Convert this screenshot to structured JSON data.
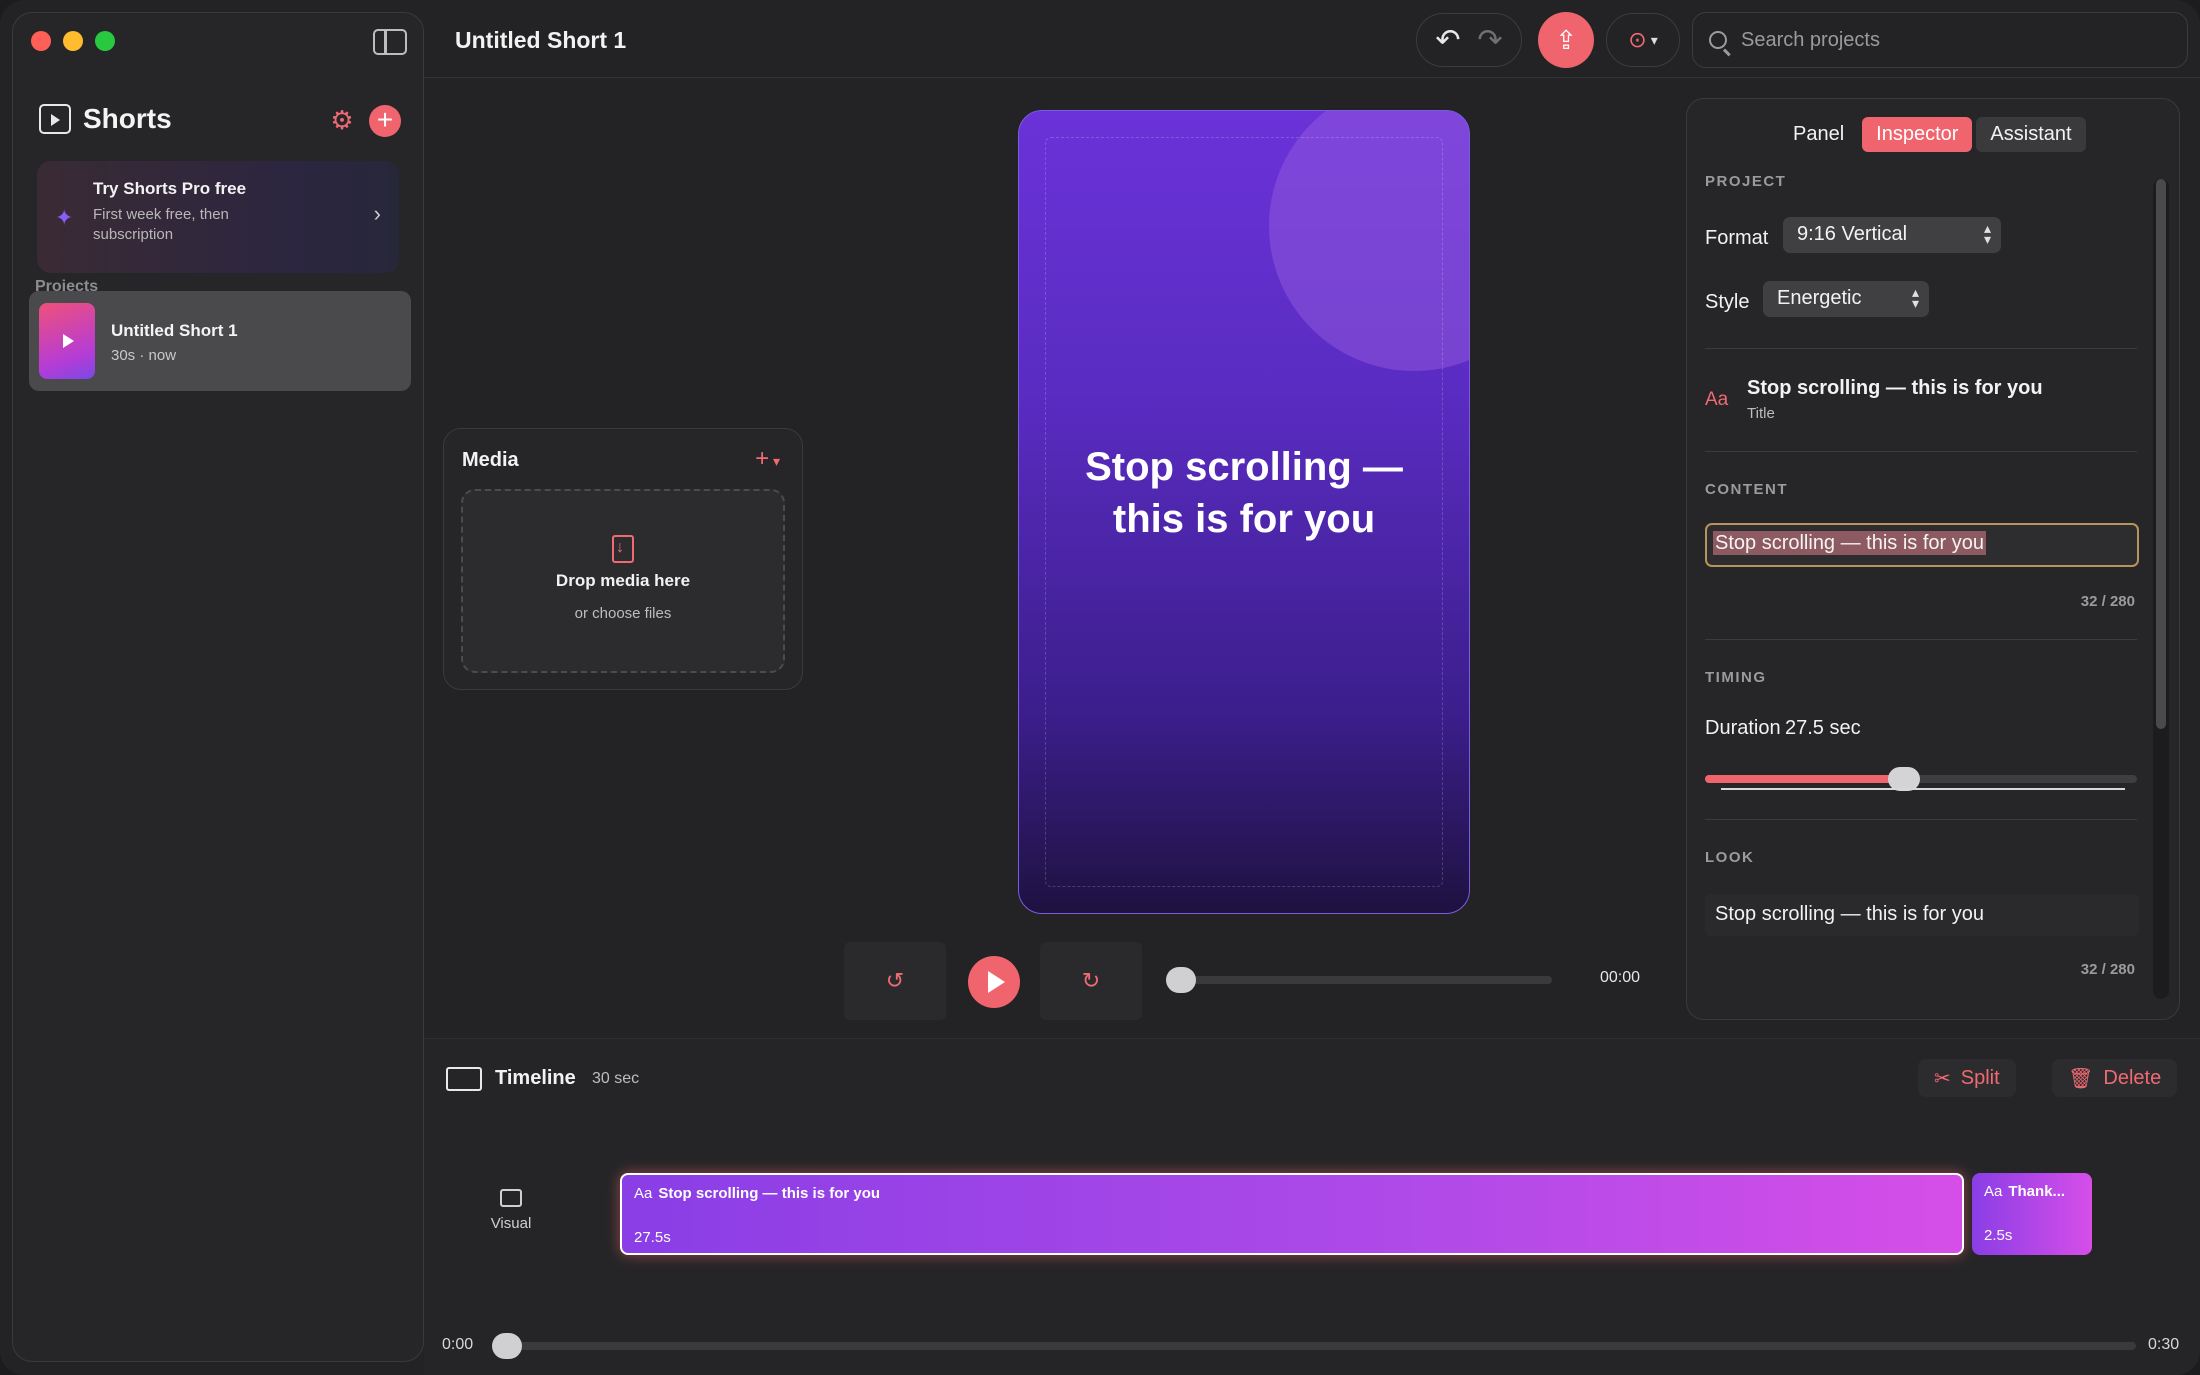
{
  "sidebar": {
    "app_title": "Shorts",
    "promo": {
      "title": "Try Shorts Pro free",
      "subtitle": "First week free, then subscription"
    },
    "projects_label": "Projects",
    "projects": [
      {
        "name": "Untitled Short 1",
        "meta": "30s · now"
      }
    ]
  },
  "topbar": {
    "title": "Untitled Short 1",
    "search_placeholder": "Search projects"
  },
  "media": {
    "title": "Media",
    "drop_title": "Drop media here",
    "drop_sub": "or choose files"
  },
  "preview": {
    "text": "Stop scrolling — this is for you",
    "time": "00:00",
    "progress": 0
  },
  "inspector": {
    "tabs": [
      "Panel",
      "Inspector",
      "Assistant"
    ],
    "active_tab": "Inspector",
    "project_label": "PROJECT",
    "format_label": "Format",
    "format_value": "9:16 Vertical",
    "style_label": "Style",
    "style_value": "Energetic",
    "item_title": "Stop scrolling — this is for you",
    "item_type": "Title",
    "content_label": "CONTENT",
    "content_value": "Stop scrolling — this is for you",
    "content_count": "32 / 280",
    "timing_label": "TIMING",
    "duration_label": "Duration",
    "duration_value": "27.5 sec",
    "duration_fraction": 0.46,
    "look_label": "LOOK",
    "look_value": "Stop scrolling — this is for you",
    "look_count": "32 / 280"
  },
  "timeline": {
    "title": "Timeline",
    "duration": "30 sec",
    "split_label": "Split",
    "delete_label": "Delete",
    "track_label": "Visual",
    "clips": [
      {
        "title": "Stop scrolling — this is for you",
        "duration": "27.5s"
      },
      {
        "title": "Thank...",
        "duration": "2.5s"
      }
    ],
    "start_time": "0:00",
    "end_time": "0:30"
  },
  "colors": {
    "accent": "#f0646e",
    "clip": "#b04ae8",
    "preview_bg": "#5a2cc2"
  }
}
